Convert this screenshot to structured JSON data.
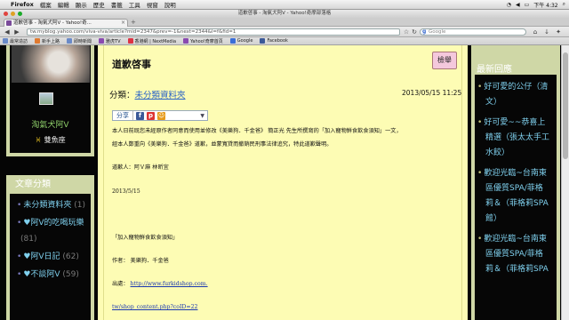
{
  "menubar": {
    "app": "Firefox",
    "menus": [
      "檔案",
      "編輯",
      "顯示",
      "歷史",
      "書籤",
      "工具",
      "視窗",
      "說明"
    ],
    "clock": "下午 4:32"
  },
  "window": {
    "title": "道歉啓事 - 淘氣犬阿V - Yahoo!奇摩部落格"
  },
  "tab": {
    "label": "道歉啓事 - 淘氣犬阿V - Yahoo!奇..."
  },
  "nav": {
    "url": "tw.myblog.yahoo.com/viva-viva/article?mid=2347&prev=-1&next=2344&l=f&fid=1",
    "search_placeholder": "Google"
  },
  "bookmarks": [
    "最常造訪",
    "新手上路",
    "即時新聞",
    "雅虎TV",
    "香港網 | NextMedia",
    "Yahoo!奇摩首頁",
    "Google",
    "Facebook"
  ],
  "left_sidebar": {
    "blogger_name": "淘氣犬阿V",
    "zodiac": "雙魚座",
    "category_heading": "文章分類",
    "categories": [
      {
        "name": "未分類資料夾",
        "count": "(1)"
      },
      {
        "name": "♥阿V的吃喝玩樂",
        "count": "(81)"
      },
      {
        "name": "♥阿V日記",
        "count": "(62)"
      },
      {
        "name": "♥不談阿V",
        "count": "(59)"
      }
    ]
  },
  "article": {
    "title": "道歉啓事",
    "report_label": "檢舉",
    "category_label": "分類：",
    "category_link": "未分類資料夾",
    "date": "2013/05/15 11:25",
    "share_label": "分享",
    "paragraph1": "本人日前既您未經原作者同意而使用並修改《美樂狗．千金爸》 簡正光 先生所撰寫的「加入寵物鮮食飲食須知」一文，",
    "paragraph2": "經本人鄭重向《美樂狗．千金爸》道歉，並蒙寬貸而撤銷民刑事法律追究，特此道歉聲明。",
    "signature": "道歉人：阿Ｖ麻 林昕宜",
    "date2": "2013/5/15",
    "quote_title": "「加入寵物鮮食飲食須知」",
    "author": "作者： 美樂狗．千金爸",
    "source_label": "出處：",
    "source_link": "http://www.furkidshop.com.",
    "source_link2": "tw/shop_content.php?coID=22"
  },
  "right_sidebar": {
    "heading": "最新回應",
    "items": [
      {
        "lines": [
          "好可愛的公仔（清",
          "文）"
        ]
      },
      {
        "lines": [
          "好可愛~~恭喜上",
          "精選（張太太手工",
          "水餃）"
        ]
      },
      {
        "lines": [
          "歡迎光臨~台南東",
          "區優質SPA/菲格",
          "莉＆（菲格莉SPA",
          "館）"
        ]
      },
      {
        "lines": [
          "歡迎光臨~台南東",
          "區優質SPA/菲格",
          "莉＆（菲格莉SPA"
        ]
      }
    ]
  },
  "colors": {
    "accent_link": "#2a63c6",
    "sidebar_text": "#7fd0ee",
    "name_green": "#8fd06a",
    "article_bg": "#fdfcb4",
    "frame": "#cfd7a6"
  }
}
